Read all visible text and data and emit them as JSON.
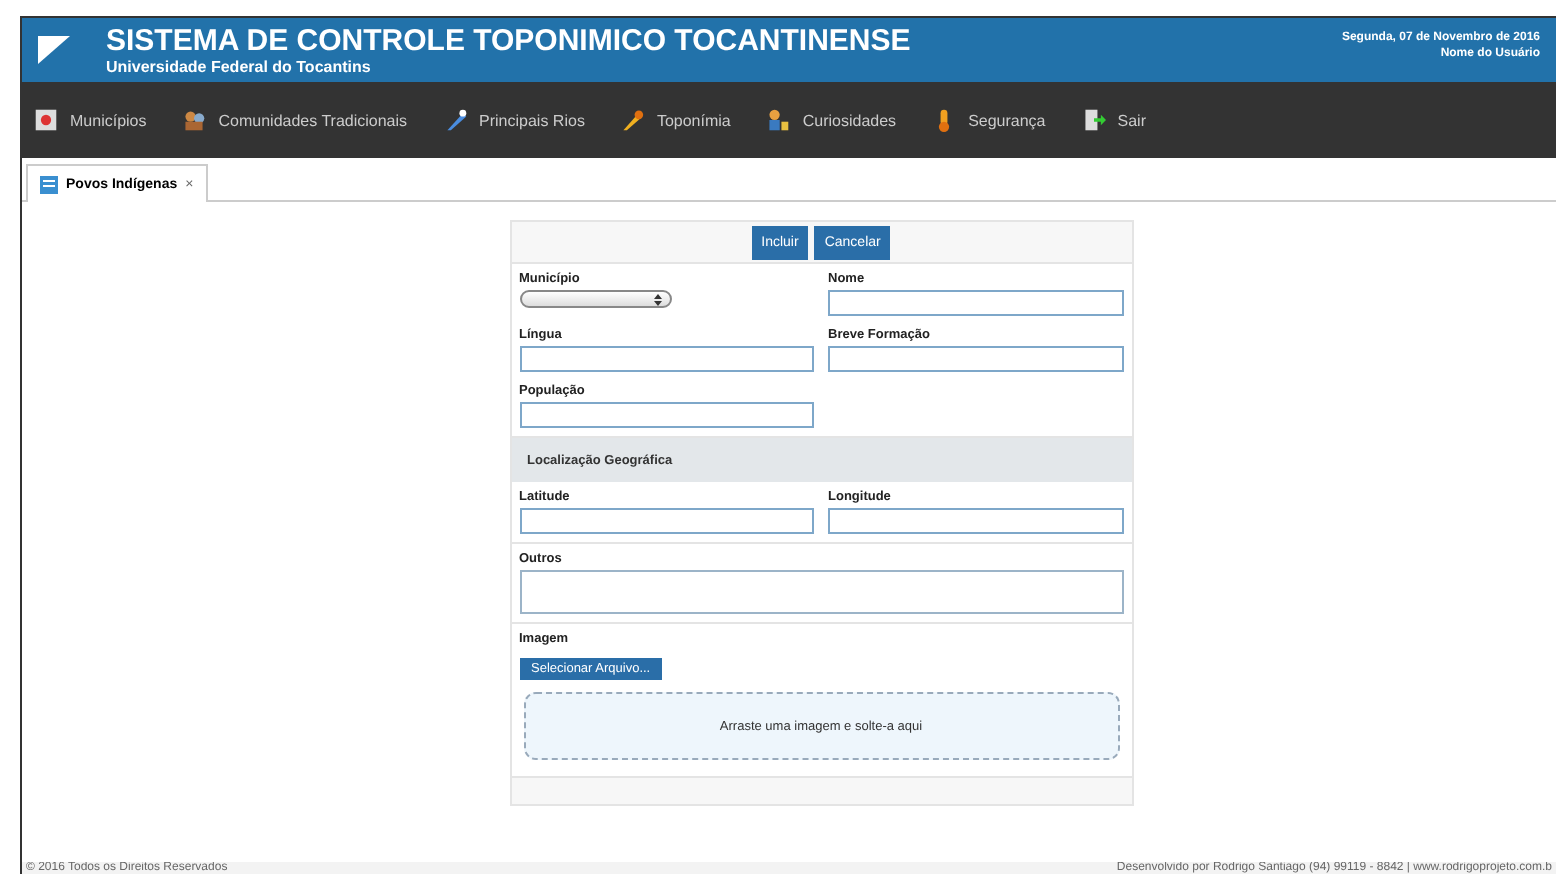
{
  "header": {
    "title": "SISTEMA DE CONTROLE TOPONIMICO TOCANTINENSE",
    "subtitle": "Universidade Federal do Tocantins",
    "date": "Segunda, 07 de Novembro de 2016",
    "user": "Nome do Usuário"
  },
  "menu": [
    {
      "label": "Municípios"
    },
    {
      "label": "Comunidades Tradicionais"
    },
    {
      "label": "Principais Rios"
    },
    {
      "label": "Toponímia"
    },
    {
      "label": "Curiosidades"
    },
    {
      "label": "Segurança"
    },
    {
      "label": "Sair"
    }
  ],
  "tabs": [
    {
      "label": "Povos Indígenas",
      "close": "×",
      "selected": true
    }
  ],
  "form": {
    "buttons": [
      "Incluir",
      "Cancelar"
    ],
    "sections": [
      {
        "rows": [
          [
            {
              "label": "Município",
              "kind": "select"
            },
            {
              "label": "Nome",
              "kind": "input"
            }
          ],
          [
            {
              "label": "Língua",
              "kind": "input"
            },
            {
              "label": "Breve Formação",
              "kind": "input"
            }
          ],
          [
            {
              "label": "População",
              "kind": "input"
            }
          ]
        ]
      },
      {
        "heading": "Localização Geográfica",
        "rows": [
          [
            {
              "label": "Latitude",
              "kind": "input"
            },
            {
              "label": "Longitude",
              "kind": "input"
            }
          ]
        ]
      },
      {
        "rows": [
          [
            {
              "label": "Outros",
              "kind": "textarea"
            }
          ]
        ]
      }
    ],
    "image": {
      "label": "Imagem",
      "button": "Selecionar Arquivo...",
      "drop": "Arraste uma imagem e solte-a aqui"
    }
  },
  "footer": {
    "left": "© 2016 Todos os Direitos Reservados",
    "right": "Desenvolvido por Rodrigo Santiago (94) 99119 - 8842 | www.rodrigoprojeto.com.b"
  }
}
